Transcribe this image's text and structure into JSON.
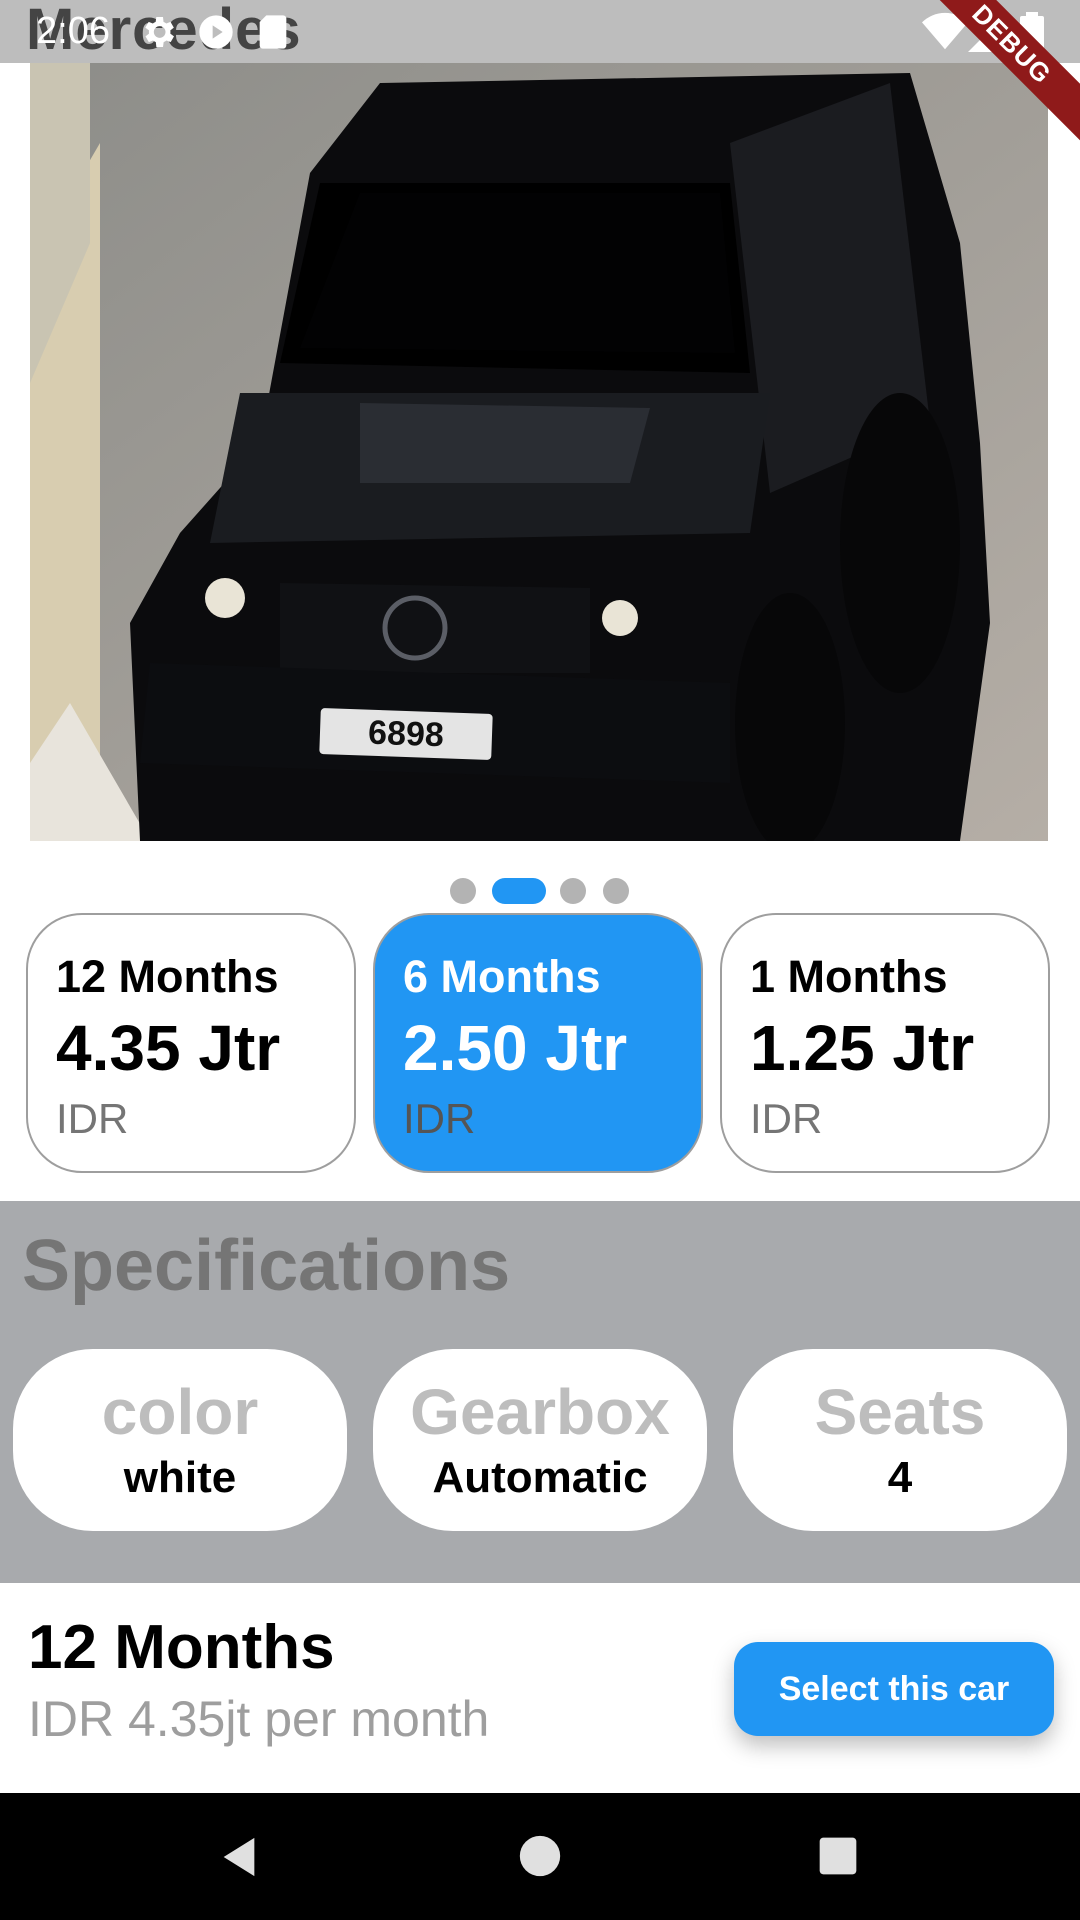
{
  "app": {
    "title": "Mercedes"
  },
  "status_bar": {
    "time": "2:06",
    "debug_label": "DEBUG"
  },
  "hero": {
    "plate": "6898",
    "icon": "car-photo"
  },
  "carousel": {
    "count": 4,
    "active_index": 1
  },
  "plans": [
    {
      "duration": "12 Months",
      "price": "4.35 Jtr",
      "currency": "IDR",
      "selected": false
    },
    {
      "duration": "6 Months",
      "price": "2.50 Jtr",
      "currency": "IDR",
      "selected": true
    },
    {
      "duration": "1 Months",
      "price": "1.25 Jtr",
      "currency": "IDR",
      "selected": false
    }
  ],
  "specifications": {
    "title": "Specifications",
    "items": [
      {
        "label": "color",
        "value": "white"
      },
      {
        "label": "Gearbox",
        "value": "Automatic"
      },
      {
        "label": "Seats",
        "value": "4"
      }
    ]
  },
  "summary": {
    "title": "12 Months",
    "subtitle": "IDR 4.35jt per month"
  },
  "select_button": {
    "label": "Select this car"
  },
  "colors": {
    "accent": "#2196f3",
    "spec_bg": "#a8aaad",
    "debug": "#8f1a1a"
  }
}
